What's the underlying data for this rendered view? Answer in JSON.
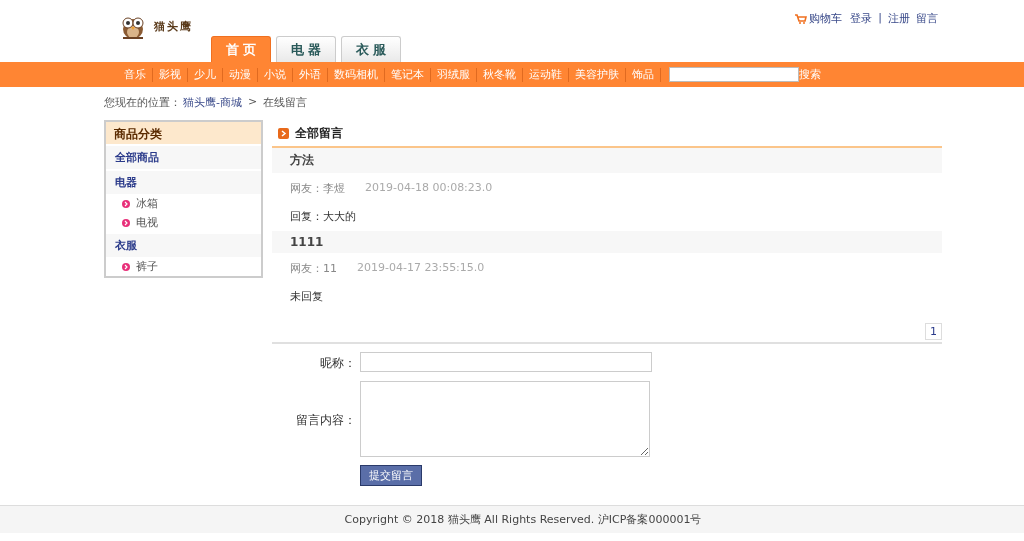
{
  "logo": {
    "text": "猫头鹰"
  },
  "top_links": [
    {
      "label": "购物车",
      "kind": "cart"
    },
    {
      "label": "登录",
      "kind": "link"
    },
    {
      "label": "|",
      "kind": "sep"
    },
    {
      "label": "注册",
      "kind": "link"
    },
    {
      "label": "留言",
      "kind": "link"
    }
  ],
  "tabs": [
    {
      "label": "首 页",
      "selected": true
    },
    {
      "label": "电 器",
      "selected": false
    },
    {
      "label": "衣 服",
      "selected": false
    }
  ],
  "nav": [
    "音乐",
    "影视",
    "少儿",
    "动漫",
    "小说",
    "外语",
    "数码相机",
    "笔记本",
    "羽绒服",
    "秋冬靴",
    "运动鞋",
    "美容护肤",
    "饰品"
  ],
  "search": {
    "button": "搜索"
  },
  "breadcrumb": {
    "prefix": "您现在的位置：",
    "home": "猫头鹰-商城",
    "sep": ">",
    "current": "在线留言"
  },
  "sidebar": {
    "title": "商品分类",
    "items": [
      {
        "label": "全部商品"
      },
      {
        "label": "电器",
        "children": [
          {
            "label": "冰箱"
          },
          {
            "label": "电视"
          }
        ]
      },
      {
        "label": "衣服",
        "children": [
          {
            "label": "裤子"
          }
        ]
      }
    ]
  },
  "messages": {
    "title": "全部留言",
    "items": [
      {
        "subject": "方法",
        "author": "网友：李煜",
        "time": "2019-04-18 00:08:23.0",
        "reply": "回复：大大的"
      },
      {
        "subject": "1111",
        "author": "网友：11",
        "time": "2019-04-17 23:55:15.0",
        "reply": "未回复"
      }
    ],
    "pages": [
      {
        "label": "1",
        "selected": true
      }
    ]
  },
  "form": {
    "nickname_label": "昵称：",
    "content_label": "留言内容：",
    "submit": "提交留言"
  },
  "footer": "Copyright © 2018 猫头鹰 All Rights Reserved. 沪ICP备案000001号"
}
